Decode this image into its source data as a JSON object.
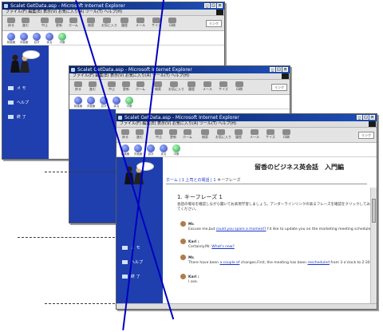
{
  "window": {
    "title": "Scalet GetData.asp - Microsoft Internet Explorer",
    "menu": "ファイル(F)  編集(E)  表示(V)  お気に入り(A)  ツール(T)  ヘルプ(H)",
    "toolbar": [
      "戻る",
      "進む",
      "中止",
      "更新",
      "ホーム",
      "検索",
      "お気に入り",
      "履歴",
      "メール",
      "サイズ",
      "印刷"
    ],
    "links_label": "リンク"
  },
  "navbuttons": [
    "前画面",
    "次画面",
    "目次",
    "戻る",
    "中断"
  ],
  "sidebar": {
    "items": [
      "メ モ",
      "ヘルプ",
      "終 了"
    ]
  },
  "page": {
    "title": "留香のビジネス英会話　入門編",
    "breadcrumb_home": "ホーム",
    "breadcrumb_course": "上司との電話",
    "breadcrumb_current": "キーフレーズ",
    "section": "1. キーフレーズ 1",
    "intro": "会話の場号を確認しながら聞いてお表現学習しましょう。アンダーラインリンクの表るフレーズを確認をクリックしてみてください。",
    "dialogue": [
      {
        "speaker": "Mr.",
        "pre": "Excuse me,but ",
        "link": "could you spare a moment?",
        "post": " I'd like to update you on the marketing meeting schedule."
      },
      {
        "speaker": "Karl :",
        "pre": "Certainly.Mr. ",
        "link": "What's new?",
        "post": ""
      },
      {
        "speaker": "Mr.",
        "pre": "There have been ",
        "link": "a couple of",
        "post": " changes.First, the meeting has been ",
        "link2": "rescheduled",
        "post2": " from 3 o'clock to 2:30."
      },
      {
        "speaker": "Karl :",
        "pre": "I see.",
        "link": "",
        "post": ""
      }
    ]
  }
}
